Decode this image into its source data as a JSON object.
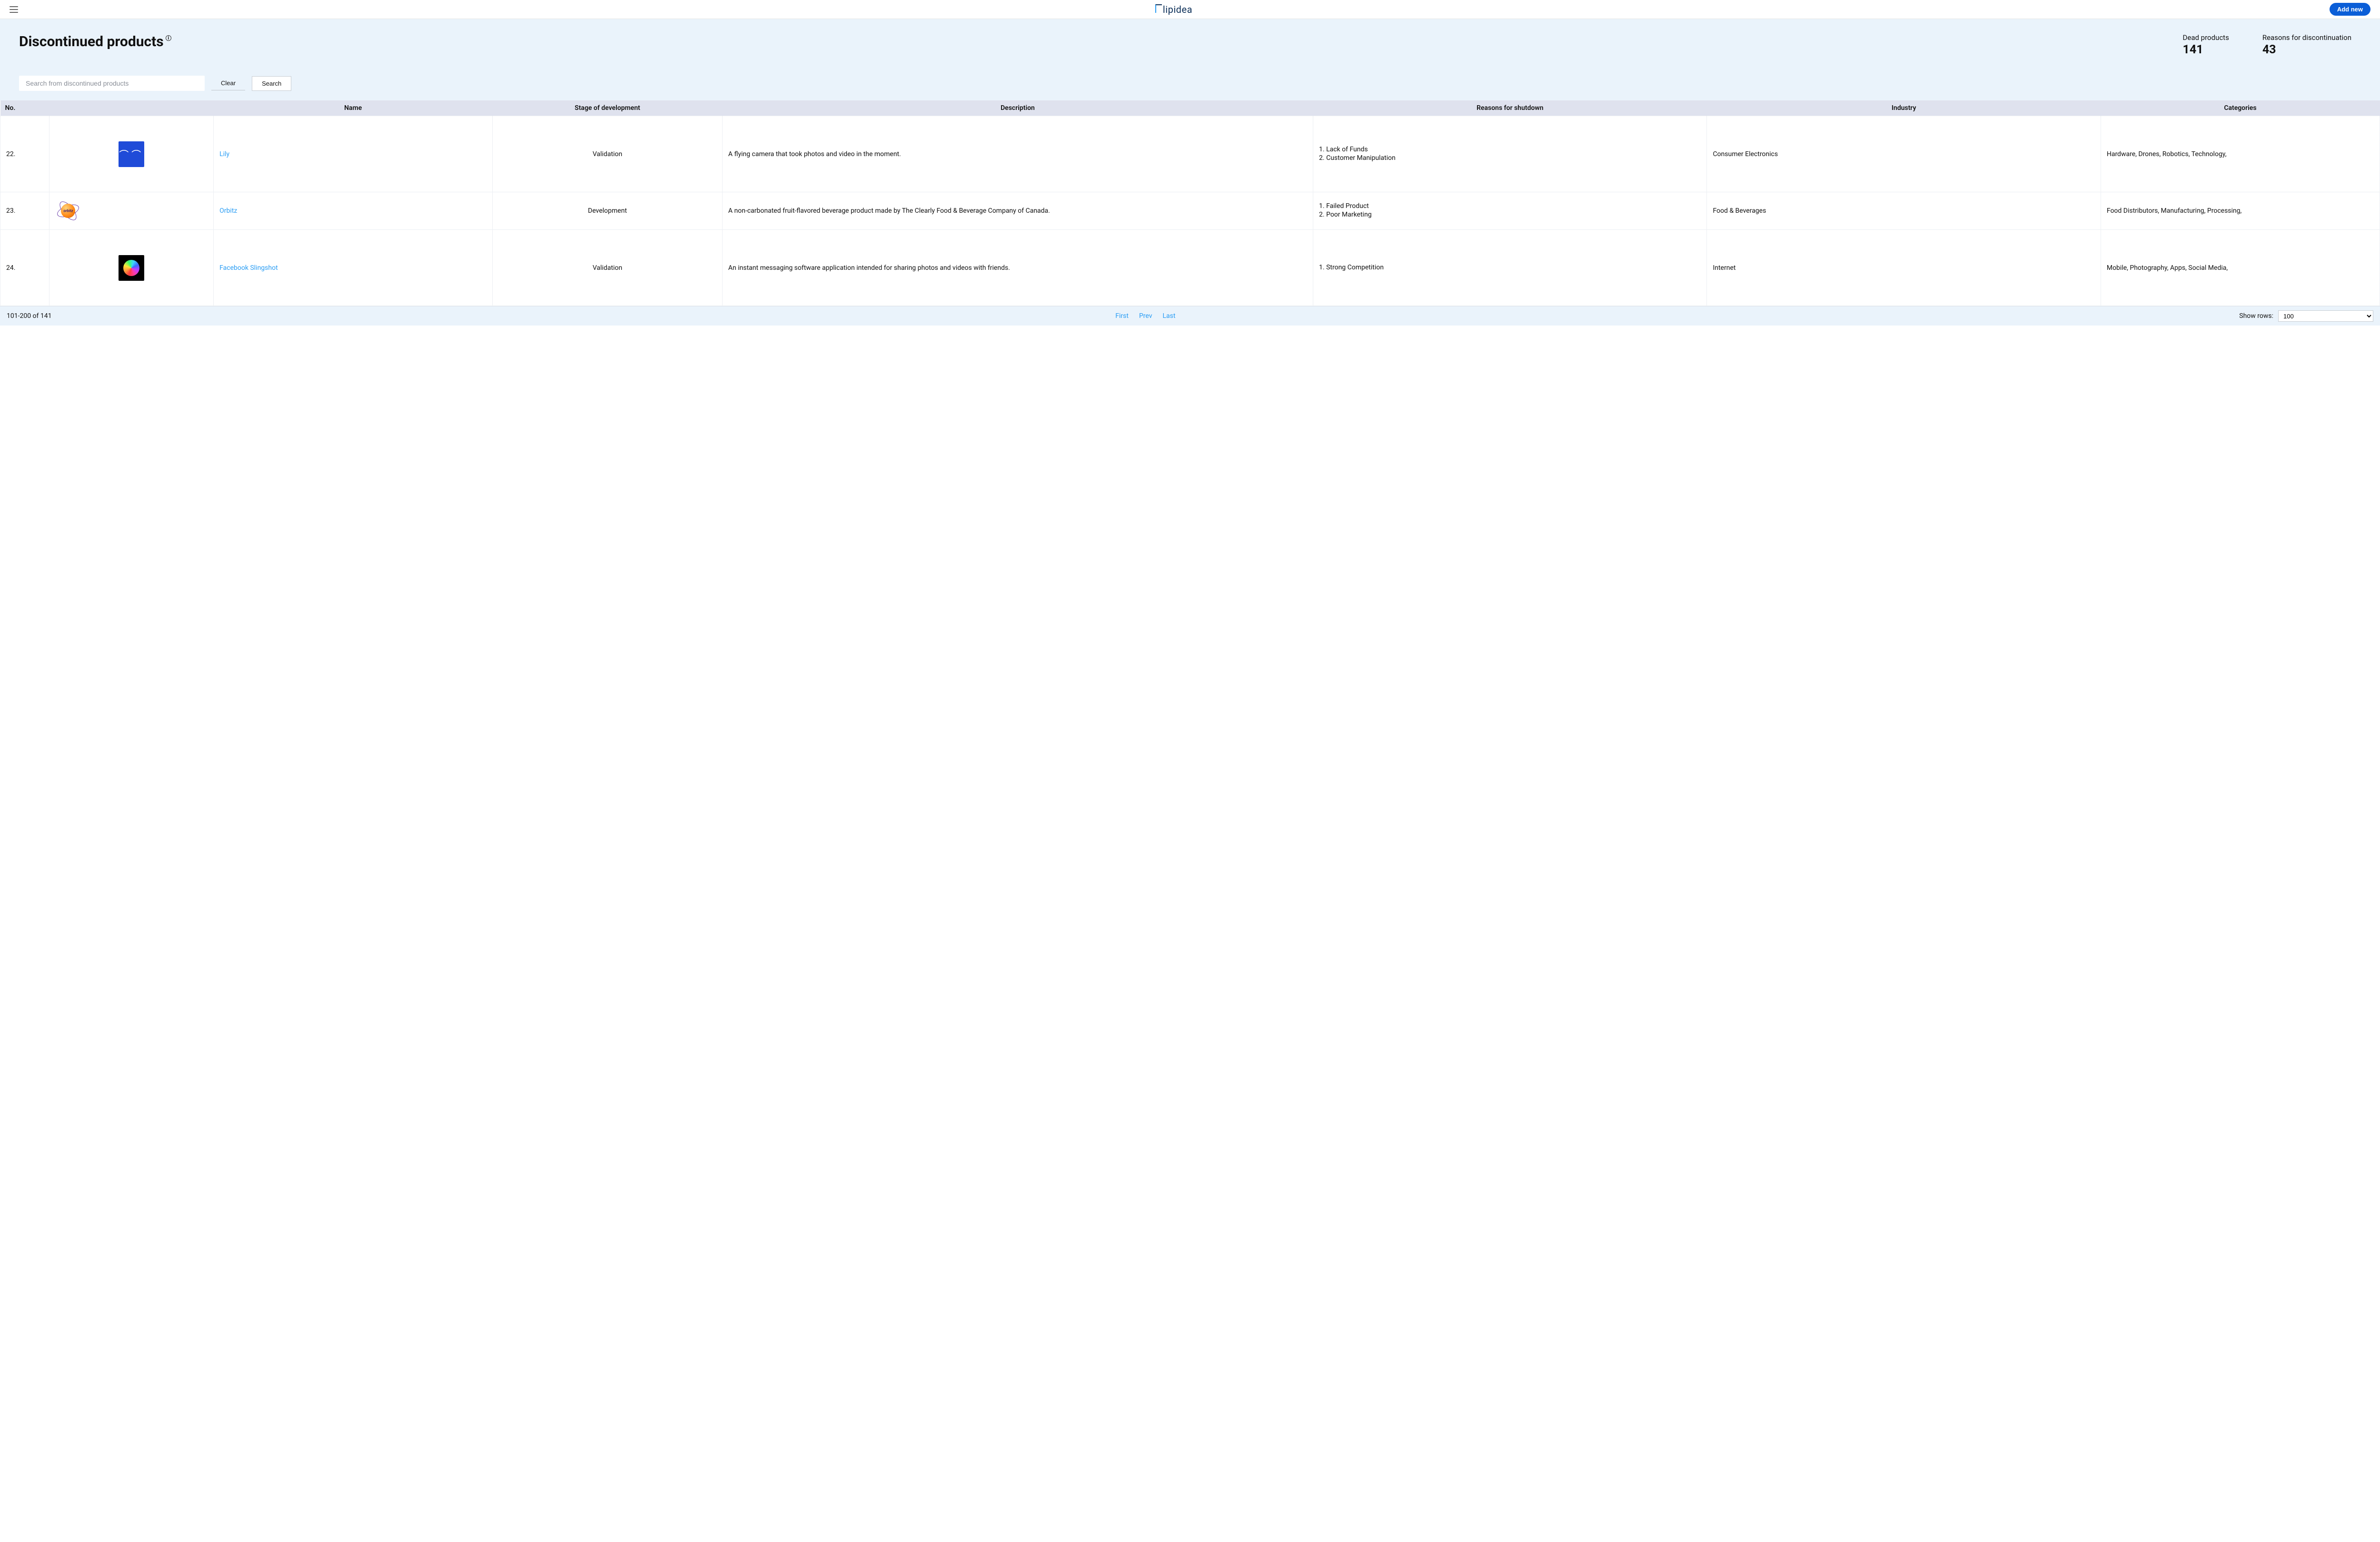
{
  "header": {
    "brand_text": "lipidea",
    "add_new_label": "Add new"
  },
  "hero": {
    "title": "Discontinued products",
    "info_sup": "i",
    "stats": {
      "dead_label": "Dead products",
      "dead_value": "141",
      "reasons_label": "Reasons for discontinuation",
      "reasons_value": "43"
    },
    "search": {
      "placeholder": "Search from discontinued products",
      "clear_label": "Clear",
      "search_label": "Search"
    }
  },
  "table": {
    "headers": {
      "no": "No.",
      "logo": "",
      "name": "Name",
      "stage": "Stage of development",
      "desc": "Description",
      "reasons": "Reasons for shutdown",
      "industry": "Industry",
      "categories": "Categories"
    },
    "rows": [
      {
        "no": "22.",
        "name": "Lily",
        "stage": "Validation",
        "desc": "A flying camera that took photos and video in the moment.",
        "reasons": [
          "Lack of Funds",
          "Customer Manipulation"
        ],
        "industry": "Consumer Electronics",
        "categories": "Hardware, Drones, Robotics, Technology,",
        "logo_kind": "lily"
      },
      {
        "no": "23.",
        "name": "Orbitz",
        "stage": "Development",
        "desc": "A non-carbonated fruit-flavored beverage product made by The Clearly Food & Beverage Company of Canada.",
        "reasons": [
          "Failed Product",
          "Poor Marketing"
        ],
        "industry": "Food & Beverages",
        "categories": "Food Distributors, Manufacturing, Processing,",
        "logo_kind": "orbitz",
        "logo_text": "orbitz"
      },
      {
        "no": "24.",
        "name": "Facebook Slingshot",
        "stage": "Validation",
        "desc": "An instant messaging software application intended for sharing photos and videos with friends.",
        "reasons": [
          "Strong Competition"
        ],
        "industry": "Internet",
        "categories": "Mobile, Photography, Apps, Social Media,",
        "logo_kind": "slingshot"
      }
    ]
  },
  "footer": {
    "range": "101-200 of 141",
    "first": "First",
    "prev": "Prev",
    "last": "Last",
    "show_rows_label": "Show rows:",
    "show_rows_value": "100"
  }
}
